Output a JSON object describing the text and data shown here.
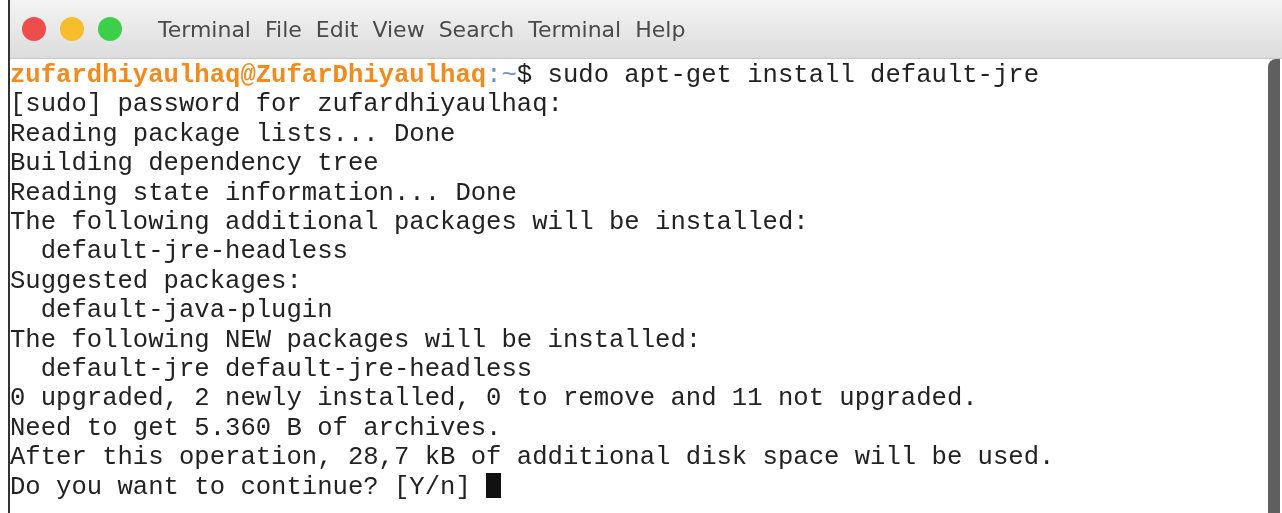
{
  "menu": [
    {
      "label": "Terminal"
    },
    {
      "label": "File"
    },
    {
      "label": "Edit"
    },
    {
      "label": "View"
    },
    {
      "label": "Search"
    },
    {
      "label": "Terminal"
    },
    {
      "label": "Help"
    }
  ],
  "prompt": {
    "user_host": "zufardhiyaulhaq@ZufarDhiyaulhaq",
    "separator": ":",
    "path": "~",
    "symbol": "$",
    "command": "sudo apt-get install default-jre"
  },
  "output": [
    "[sudo] password for zufardhiyaulhaq:",
    "Reading package lists... Done",
    "Building dependency tree",
    "Reading state information... Done",
    "The following additional packages will be installed:",
    "  default-jre-headless",
    "Suggested packages:",
    "  default-java-plugin",
    "The following NEW packages will be installed:",
    "  default-jre default-jre-headless",
    "0 upgraded, 2 newly installed, 0 to remove and 11 not upgraded.",
    "Need to get 5.360 B of archives.",
    "After this operation, 28,7 kB of additional disk space will be used."
  ],
  "question": "Do you want to continue? [Y/n] "
}
